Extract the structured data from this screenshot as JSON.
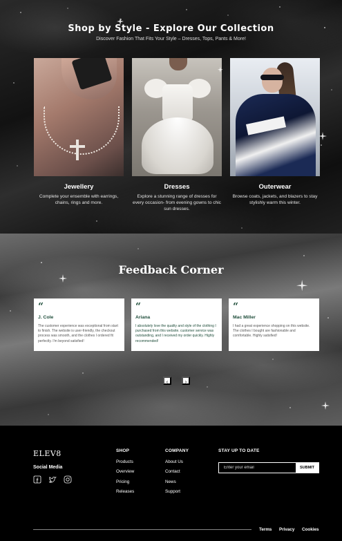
{
  "collection": {
    "title": "Shop by Style - Explore Our Collection",
    "subtitle": "Discover Fashion That Fits Your Style – Dresses, Tops, Pants & More!",
    "cards": [
      {
        "name": "Jewellery",
        "description": "Complete your ensemble with earrings, chains, rings and more."
      },
      {
        "name": "Dresses",
        "description": "Explore a stunning range of dresses for every occasion- from evening gowns to chic sun dresses."
      },
      {
        "name": "Outerwear",
        "description": "Browse coats, jackets, and blazers to stay stylishly warm this winter."
      }
    ]
  },
  "feedback": {
    "title": "Feedback Corner",
    "quote_mark": "“",
    "reviews": [
      {
        "name": "J. Cole",
        "text": "The customer experience was exceptional from start to finish. The website is user-friendly, the checkout process was smooth, and the clothes I ordered fit perfectly. I'm beyond satisfied!"
      },
      {
        "name": "Ariana",
        "text": "I absolutely love the quality and style of the clothing I purchased from this website. customer service was outstanding, and I received my order quickly. Highly recommended!"
      },
      {
        "name": "Mac Miller",
        "text": "I had a great experience shopping on this website. The clothes I bought are fashionable and comfortable. Highly satisfied!"
      }
    ],
    "prev_label": "‹",
    "next_label": "›"
  },
  "footer": {
    "logo": "ELEV8",
    "social_label": "Social Media",
    "social_icons": [
      "facebook-icon",
      "twitter-icon",
      "instagram-icon"
    ],
    "shop": {
      "heading": "SHOP",
      "links": [
        "Products",
        "Overview",
        "Pricing",
        "Releases"
      ]
    },
    "company": {
      "heading": "COMPANY",
      "links": [
        "About Us",
        "Contact",
        "News",
        "Support"
      ]
    },
    "newsletter": {
      "heading": "STAY UP TO DATE",
      "placeholder": "Enter your email",
      "submit_label": "SUBMIT"
    },
    "legal": [
      "Terms",
      "Privacy",
      "Cookies"
    ]
  },
  "colors": {
    "accent_green": "#1e4d3a",
    "background": "#000000",
    "card_background": "#ffffff"
  }
}
